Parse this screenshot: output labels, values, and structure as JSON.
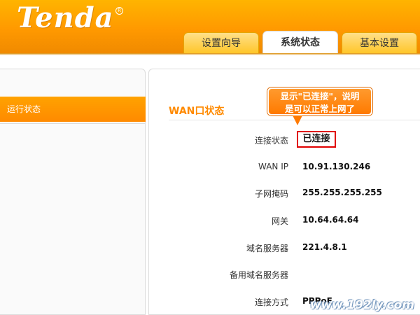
{
  "header": {
    "logo": "Tenda",
    "logo_mark": "R",
    "brand_color": "#ff9900"
  },
  "tabs": [
    {
      "label": "设置向导",
      "active": false
    },
    {
      "label": "系统状态",
      "active": true
    },
    {
      "label": "基本设置",
      "active": false
    }
  ],
  "sidebar": {
    "items": [
      {
        "label": "运行状态",
        "active": true
      }
    ]
  },
  "section": {
    "title": "WAN口状态"
  },
  "callout": {
    "line1": "显示\"已连接\"，说明",
    "line2": "是可以正常上网了",
    "color": "#ff7a00"
  },
  "wan": {
    "rows": [
      {
        "label": "连接状态",
        "value": "已连接"
      },
      {
        "label": "WAN IP",
        "value": "10.91.130.246"
      },
      {
        "label": "子网掩码",
        "value": "255.255.255.255"
      },
      {
        "label": "网关",
        "value": "10.64.64.64"
      },
      {
        "label": "域名服务器",
        "value": "221.4.8.1"
      },
      {
        "label": "备用域名服务器",
        "value": ""
      },
      {
        "label": "连接方式",
        "value": "PPPoE"
      }
    ]
  },
  "watermark": "www.192ly.com"
}
